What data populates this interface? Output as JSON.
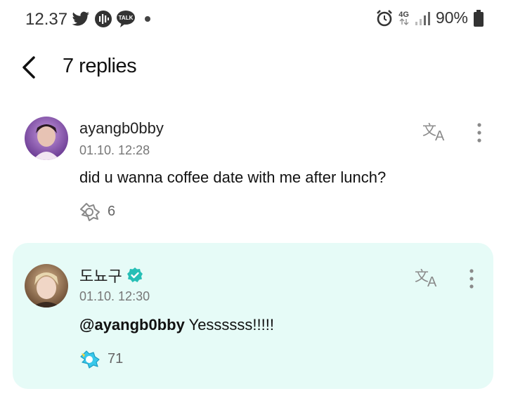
{
  "status_bar": {
    "time": "12.37",
    "talk_badge": "TALK",
    "network": "4G",
    "battery": "90%"
  },
  "header": {
    "title": "7 replies"
  },
  "comments": [
    {
      "author": "ayangb0bby",
      "timestamp": "01.10. 12:28",
      "text": "did u wanna coffee date with me after lunch?",
      "reaction_count": "6",
      "verified": false
    },
    {
      "author": "도뇨구",
      "timestamp": "01.10. 12:30",
      "mention": "@ayangb0bby",
      "text": " Yessssss!!!!!",
      "reaction_count": "71",
      "verified": true
    }
  ],
  "colors": {
    "reply_bg": "#e6fbf7",
    "verified": "#27bfb6",
    "icon_gray": "#8a8a8a"
  }
}
